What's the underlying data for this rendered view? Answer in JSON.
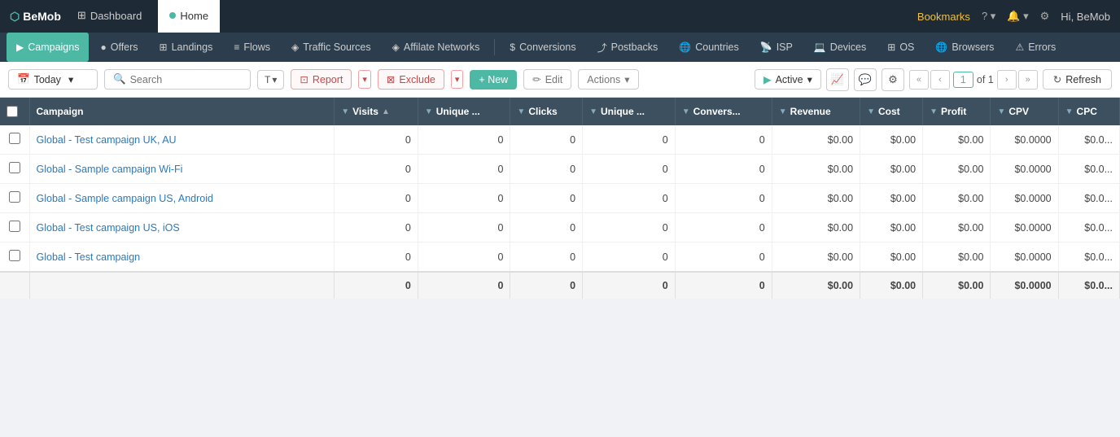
{
  "topNav": {
    "logo": "BeMob",
    "tabs": [
      {
        "id": "dashboard",
        "label": "Dashboard",
        "active": false
      },
      {
        "id": "home",
        "label": "Home",
        "active": true
      }
    ],
    "right": {
      "bookmarks": "Bookmarks",
      "help": "?",
      "notifications": "🔔",
      "settings": "⚙",
      "user": "Hi, BeMob"
    }
  },
  "subNav": {
    "items": [
      {
        "id": "campaigns",
        "label": "Campaigns",
        "icon": "▶",
        "active": true
      },
      {
        "id": "offers",
        "label": "Offers",
        "icon": "●"
      },
      {
        "id": "landings",
        "label": "Landings",
        "icon": "⊞"
      },
      {
        "id": "flows",
        "label": "Flows",
        "icon": "≡"
      },
      {
        "id": "traffic-sources",
        "label": "Traffic Sources",
        "icon": "◈"
      },
      {
        "id": "affiliate-networks",
        "label": "Affilate Networks",
        "icon": "◈"
      },
      {
        "id": "conversions",
        "label": "Conversions",
        "icon": "$"
      },
      {
        "id": "postbacks",
        "label": "Postbacks",
        "icon": "⤴"
      },
      {
        "id": "countries",
        "label": "Countries",
        "icon": "🌐"
      },
      {
        "id": "isp",
        "label": "ISP",
        "icon": "📡"
      },
      {
        "id": "devices",
        "label": "Devices",
        "icon": "💻"
      },
      {
        "id": "os",
        "label": "OS",
        "icon": "⊞"
      },
      {
        "id": "browsers",
        "label": "Browsers",
        "icon": "🌐"
      },
      {
        "id": "errors",
        "label": "Errors",
        "icon": "⚠"
      }
    ]
  },
  "toolbar": {
    "dateLabel": "Today",
    "searchPlaceholder": "Search",
    "tLabel": "T",
    "reportLabel": "Report",
    "excludeLabel": "Exclude",
    "newLabel": "+ New",
    "editLabel": "Edit",
    "actionsLabel": "Actions",
    "activeLabel": "Active",
    "pageNum": "1",
    "pageOf": "of 1",
    "refreshLabel": "Refresh"
  },
  "table": {
    "columns": [
      {
        "id": "checkbox",
        "label": ""
      },
      {
        "id": "campaign",
        "label": "Campaign"
      },
      {
        "id": "visits",
        "label": "Visits"
      },
      {
        "id": "unique1",
        "label": "Unique ..."
      },
      {
        "id": "clicks",
        "label": "Clicks"
      },
      {
        "id": "unique2",
        "label": "Unique ..."
      },
      {
        "id": "conversions",
        "label": "Convers..."
      },
      {
        "id": "revenue",
        "label": "Revenue"
      },
      {
        "id": "cost",
        "label": "Cost"
      },
      {
        "id": "profit",
        "label": "Profit"
      },
      {
        "id": "cpv",
        "label": "CPV"
      },
      {
        "id": "cpc",
        "label": "CPC"
      }
    ],
    "rows": [
      {
        "campaign": "Global - Test campaign UK, AU",
        "visits": "0",
        "unique1": "0",
        "clicks": "0",
        "unique2": "0",
        "conversions": "0",
        "revenue": "$0.00",
        "cost": "$0.00",
        "profit": "$0.00",
        "cpv": "$0.0000",
        "cpc": "$0.0..."
      },
      {
        "campaign": "Global - Sample campaign Wi-Fi",
        "visits": "0",
        "unique1": "0",
        "clicks": "0",
        "unique2": "0",
        "conversions": "0",
        "revenue": "$0.00",
        "cost": "$0.00",
        "profit": "$0.00",
        "cpv": "$0.0000",
        "cpc": "$0.0..."
      },
      {
        "campaign": "Global - Sample campaign US, Android",
        "visits": "0",
        "unique1": "0",
        "clicks": "0",
        "unique2": "0",
        "conversions": "0",
        "revenue": "$0.00",
        "cost": "$0.00",
        "profit": "$0.00",
        "cpv": "$0.0000",
        "cpc": "$0.0..."
      },
      {
        "campaign": "Global - Test campaign US, iOS",
        "visits": "0",
        "unique1": "0",
        "clicks": "0",
        "unique2": "0",
        "conversions": "0",
        "revenue": "$0.00",
        "cost": "$0.00",
        "profit": "$0.00",
        "cpv": "$0.0000",
        "cpc": "$0.0..."
      },
      {
        "campaign": "Global - Test campaign",
        "visits": "0",
        "unique1": "0",
        "clicks": "0",
        "unique2": "0",
        "conversions": "0",
        "revenue": "$0.00",
        "cost": "$0.00",
        "profit": "$0.00",
        "cpv": "$0.0000",
        "cpc": "$0.0..."
      }
    ],
    "footer": {
      "visits": "0",
      "unique1": "0",
      "clicks": "0",
      "unique2": "0",
      "conversions": "0",
      "revenue": "$0.00",
      "cost": "$0.00",
      "profit": "$0.00",
      "cpv": "$0.0000",
      "cpc": "$0.0..."
    }
  }
}
